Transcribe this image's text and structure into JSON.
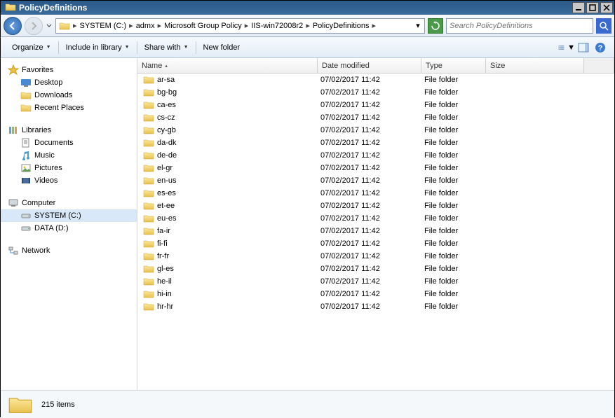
{
  "window": {
    "title": "PolicyDefinitions"
  },
  "breadcrumb": {
    "items": [
      "SYSTEM (C:)",
      "admx",
      "Microsoft Group Policy",
      "IIS-win72008r2",
      "PolicyDefinitions"
    ]
  },
  "search": {
    "placeholder": "Search PolicyDefinitions"
  },
  "toolbar": {
    "organize": "Organize",
    "include": "Include in library",
    "share": "Share with",
    "newfolder": "New folder"
  },
  "sidebar": {
    "favorites": {
      "label": "Favorites",
      "items": [
        "Desktop",
        "Downloads",
        "Recent Places"
      ]
    },
    "libraries": {
      "label": "Libraries",
      "items": [
        "Documents",
        "Music",
        "Pictures",
        "Videos"
      ]
    },
    "computer": {
      "label": "Computer",
      "items": [
        "SYSTEM (C:)",
        "DATA (D:)"
      ],
      "selected": 0
    },
    "network": {
      "label": "Network"
    }
  },
  "columns": {
    "name": "Name",
    "date": "Date modified",
    "type": "Type",
    "size": "Size"
  },
  "rows": [
    {
      "name": "ar-sa",
      "date": "07/02/2017 11:42",
      "type": "File folder"
    },
    {
      "name": "bg-bg",
      "date": "07/02/2017 11:42",
      "type": "File folder"
    },
    {
      "name": "ca-es",
      "date": "07/02/2017 11:42",
      "type": "File folder"
    },
    {
      "name": "cs-cz",
      "date": "07/02/2017 11:42",
      "type": "File folder"
    },
    {
      "name": "cy-gb",
      "date": "07/02/2017 11:42",
      "type": "File folder"
    },
    {
      "name": "da-dk",
      "date": "07/02/2017 11:42",
      "type": "File folder"
    },
    {
      "name": "de-de",
      "date": "07/02/2017 11:42",
      "type": "File folder"
    },
    {
      "name": "el-gr",
      "date": "07/02/2017 11:42",
      "type": "File folder"
    },
    {
      "name": "en-us",
      "date": "07/02/2017 11:42",
      "type": "File folder"
    },
    {
      "name": "es-es",
      "date": "07/02/2017 11:42",
      "type": "File folder"
    },
    {
      "name": "et-ee",
      "date": "07/02/2017 11:42",
      "type": "File folder"
    },
    {
      "name": "eu-es",
      "date": "07/02/2017 11:42",
      "type": "File folder"
    },
    {
      "name": "fa-ir",
      "date": "07/02/2017 11:42",
      "type": "File folder"
    },
    {
      "name": "fi-fi",
      "date": "07/02/2017 11:42",
      "type": "File folder"
    },
    {
      "name": "fr-fr",
      "date": "07/02/2017 11:42",
      "type": "File folder"
    },
    {
      "name": "gl-es",
      "date": "07/02/2017 11:42",
      "type": "File folder"
    },
    {
      "name": "he-il",
      "date": "07/02/2017 11:42",
      "type": "File folder"
    },
    {
      "name": "hi-in",
      "date": "07/02/2017 11:42",
      "type": "File folder"
    },
    {
      "name": "hr-hr",
      "date": "07/02/2017 11:42",
      "type": "File folder"
    }
  ],
  "status": {
    "count": "215 items"
  }
}
